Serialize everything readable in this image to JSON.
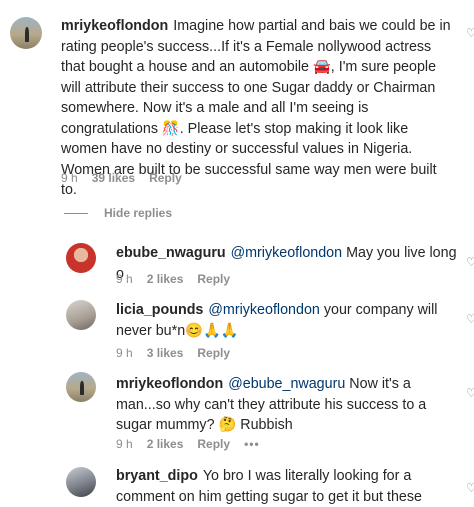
{
  "comments": [
    {
      "username": "mriykeoflondon",
      "mention": "",
      "text": "Imagine how partial and bais we could be in rating people's success...If it's a Female nollywood actress that bought a house and an automobile 🚘, I'm sure people will attribute their success to one Sugar daddy or Chairman somewhere. Now it's a male and all I'm seeing is congratulations 🎊. Please let's stop making it look like women have no destiny or successful values in Nigeria. Women are built to be successful same way men were built to.",
      "time": "9 h",
      "likes": "39 likes",
      "reply": "Reply"
    }
  ],
  "hide_replies": "Hide replies",
  "replies": [
    {
      "username": "ebube_nwaguru",
      "mention": "@mriykeoflondon",
      "text": "May you live long o",
      "time": "9 h",
      "likes": "2 likes",
      "reply": "Reply"
    },
    {
      "username": "licia_pounds",
      "mention": "@mriykeoflondon",
      "text": "your company will never bu*n😊🙏🙏",
      "time": "9 h",
      "likes": "3 likes",
      "reply": "Reply"
    },
    {
      "username": "mriykeoflondon",
      "mention": "@ebube_nwaguru",
      "text": "Now it's a man...so why can't they attribute his success to a sugar mummy? 🤔 Rubbish",
      "time": "9 h",
      "likes": "2 likes",
      "reply": "Reply",
      "more": "•••"
    },
    {
      "username": "bryant_dipo",
      "mention": "",
      "text": "Yo bro I was literally looking for a comment on him getting sugar to get it but these"
    }
  ],
  "icons": {
    "like": "heart-outline-icon",
    "more": "more-options-icon"
  }
}
